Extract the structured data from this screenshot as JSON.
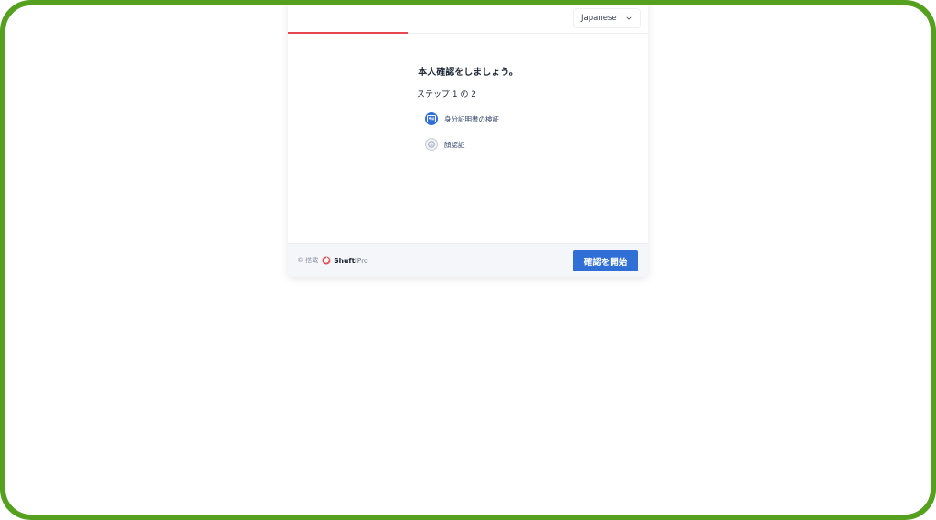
{
  "header": {
    "language": "Japanese"
  },
  "main": {
    "title": "本人確認をしましょう。",
    "step_count": "ステップ 1 の 2",
    "steps": [
      {
        "label": "身分証明書の検証",
        "state": "active"
      },
      {
        "label": "顔認証",
        "state": "pending"
      }
    ]
  },
  "footer": {
    "powered_by": "© 搭載",
    "logo_name_bold": "Shufti",
    "logo_name_light": "Pro",
    "start_button": "確認を開始"
  },
  "colors": {
    "accent": "#2f6fd6",
    "progress": "#e5484d",
    "frame": "#55a01f"
  }
}
